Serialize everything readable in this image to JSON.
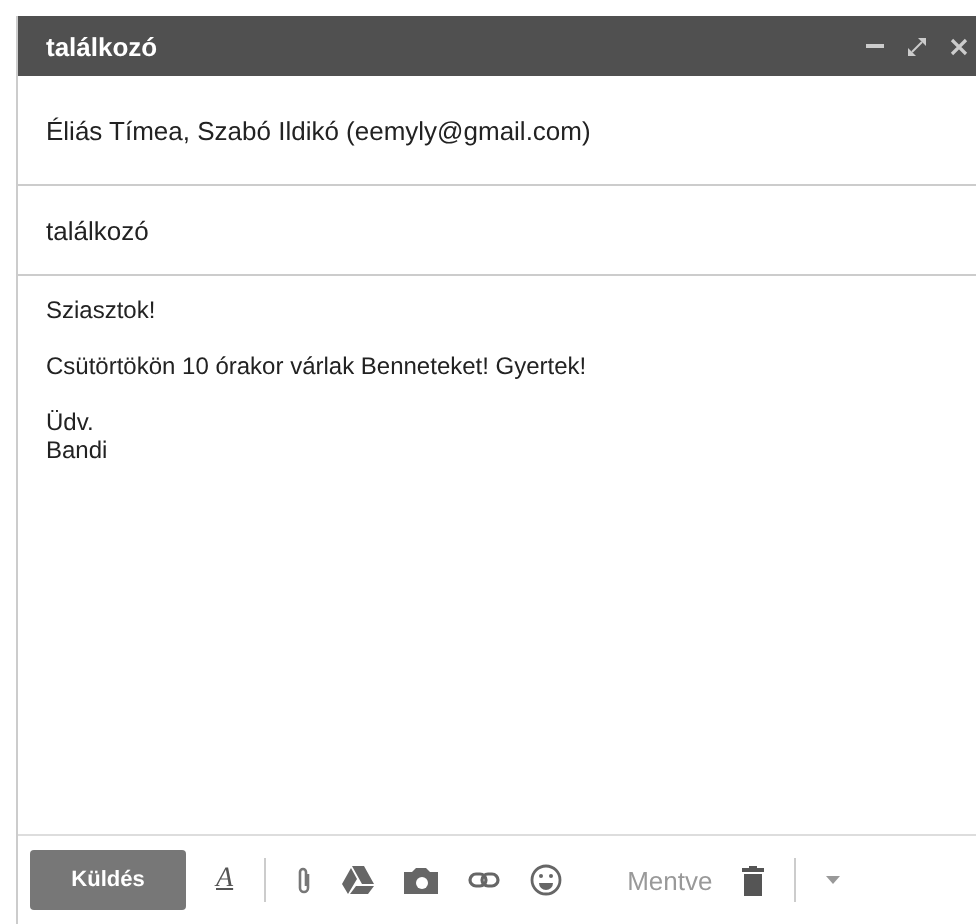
{
  "window": {
    "title": "találkozó"
  },
  "recipients": "Éliás Tímea, Szabó Ildikó (eemyly@gmail.com)",
  "subject": "találkozó",
  "body": [
    [
      "Sziasztok!"
    ],
    [
      "Csütörtökön 10 órakor várlak Benneteket! Gyertek!"
    ],
    [
      "Üdv.",
      "Bandi"
    ]
  ],
  "toolbar": {
    "send_label": "Küldés",
    "format_label": "A",
    "status": "Mentve"
  }
}
